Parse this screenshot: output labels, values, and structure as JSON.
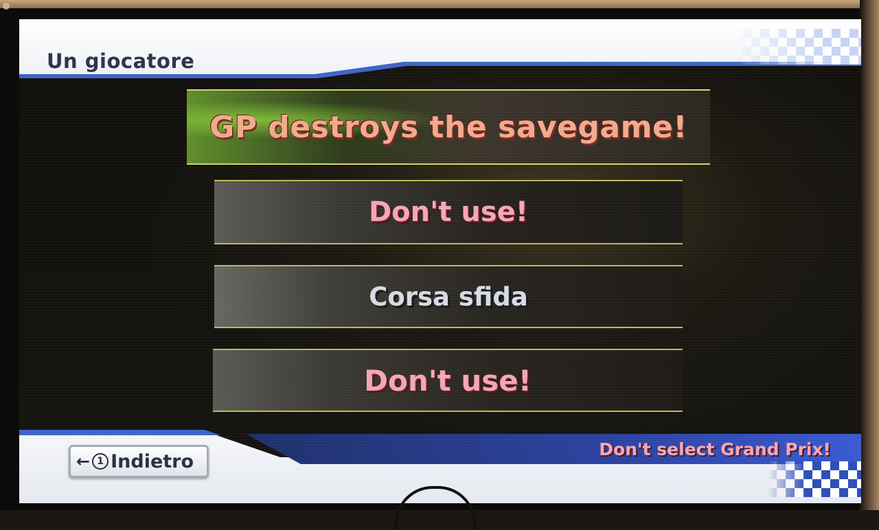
{
  "header": {
    "title": "Un giocatore"
  },
  "menu": {
    "items": [
      {
        "label": "GP destroys the savegame!",
        "color": "#f2a98e"
      },
      {
        "label": "Don't use!",
        "color": "#f4a6b3"
      },
      {
        "label": "Corsa sfida",
        "color": "#d6dbe2"
      },
      {
        "label": "Don't use!",
        "color": "#f4a6b3"
      }
    ]
  },
  "footer": {
    "back": {
      "arrow": "←",
      "button_glyph": "1",
      "label": "Indietro"
    },
    "hint": "Don't select Grand Prix!"
  },
  "colors": {
    "accent_blue": "#3d63c8",
    "hint_pink": "#f4a6b3",
    "frame_olive": "#b9bb5c"
  }
}
